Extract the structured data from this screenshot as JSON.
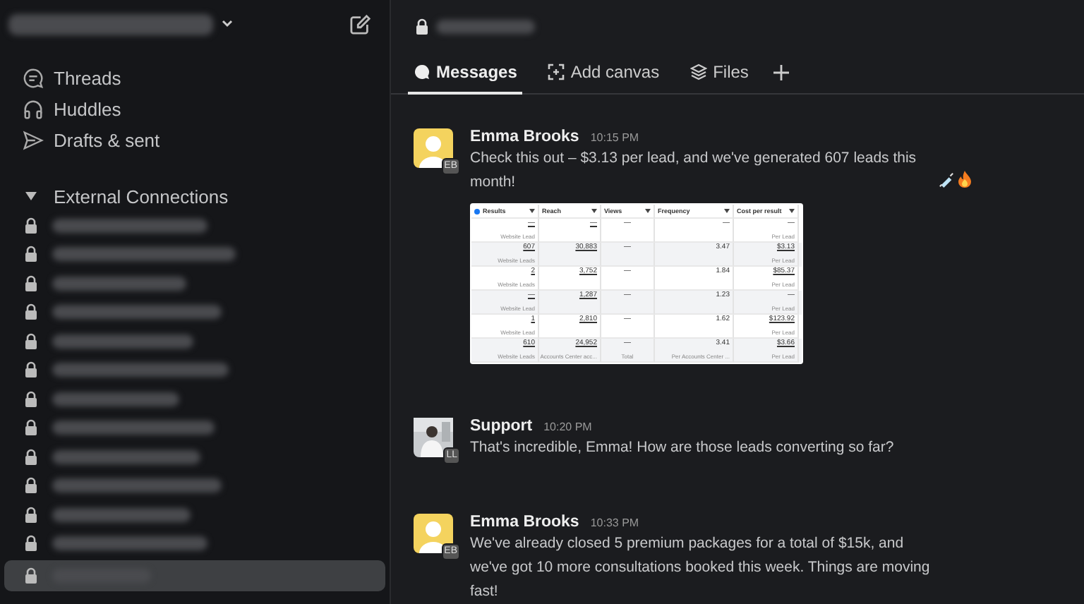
{
  "sidebar": {
    "nav": [
      {
        "kind": "threads",
        "label": "Threads"
      },
      {
        "kind": "huddles",
        "label": "Huddles"
      },
      {
        "kind": "drafts",
        "label": "Drafts & sent"
      }
    ],
    "section": {
      "label": "External Connections",
      "expanded": true
    },
    "channels": [
      {
        "selected": false
      },
      {
        "selected": false
      },
      {
        "selected": false
      },
      {
        "selected": false
      },
      {
        "selected": false
      },
      {
        "selected": false
      },
      {
        "selected": false
      },
      {
        "selected": false
      },
      {
        "selected": false
      },
      {
        "selected": false
      },
      {
        "selected": false
      },
      {
        "selected": false
      },
      {
        "selected": true
      }
    ]
  },
  "tabs": [
    {
      "kind": "messages",
      "label": "Messages",
      "selected": true
    },
    {
      "kind": "canvas",
      "label": "Add canvas",
      "selected": false
    },
    {
      "kind": "files",
      "label": "Files",
      "selected": false
    }
  ],
  "messages": [
    {
      "avatar": {
        "kind": "placeholder"
      },
      "badge": "EB",
      "author": "Emma Brooks",
      "time": "10:15 PM",
      "text": "Check this out – $3.13 per lead, and we've generated 607 leads this month!",
      "emoji": [
        {
          "kind": "syringe"
        },
        {
          "kind": "fire"
        }
      ],
      "table": {
        "columns": [
          "Results",
          "Reach",
          "Views",
          "Frequency",
          "Cost per result"
        ],
        "rows": [
          [
            {
              "value": "—",
              "sub": "Website Lead"
            },
            {
              "value": "—"
            },
            {
              "value": "—"
            },
            {
              "value": "—"
            },
            {
              "value": "—",
              "sub": "Per Lead"
            }
          ],
          [
            {
              "value": "607",
              "sub": "Website Leads"
            },
            {
              "value": "30,883"
            },
            {
              "value": "—"
            },
            {
              "value": "3.47"
            },
            {
              "value": "$3.13",
              "sub": "Per Lead"
            }
          ],
          [
            {
              "value": "2",
              "sub": "Website Leads"
            },
            {
              "value": "3,752"
            },
            {
              "value": "—"
            },
            {
              "value": "1.84"
            },
            {
              "value": "$85.37",
              "sub": "Per Lead"
            }
          ],
          [
            {
              "value": "—",
              "sub": "Website Lead"
            },
            {
              "value": "1,287"
            },
            {
              "value": "—"
            },
            {
              "value": "1.23"
            },
            {
              "value": "—",
              "sub": "Per Lead"
            }
          ],
          [
            {
              "value": "1",
              "sub": "Website Lead"
            },
            {
              "value": "2,810"
            },
            {
              "value": "—"
            },
            {
              "value": "1.62"
            },
            {
              "value": "$123.92",
              "sub": "Per Lead"
            }
          ],
          [
            {
              "value": "610",
              "sub": "Website Leads"
            },
            {
              "value": "24,952",
              "sub": "Accounts Center acc..."
            },
            {
              "value": "—",
              "sub": "Total"
            },
            {
              "value": "3.41",
              "sub": "Per Accounts Center ..."
            },
            {
              "value": "$3.66",
              "sub": "Per Lead"
            }
          ]
        ]
      }
    },
    {
      "badge": "LL",
      "author": "Support",
      "time": "10:20 PM",
      "text": "That's incredible, Emma! How are those leads converting so far?"
    },
    {
      "avatar": {
        "kind": "placeholder"
      },
      "badge": "EB",
      "author": "Emma Brooks",
      "time": "10:33 PM",
      "text": "We've already closed 5 premium packages for a total of $15k, and we've got 10 more consultations booked this week. Things are moving fast!"
    }
  ]
}
